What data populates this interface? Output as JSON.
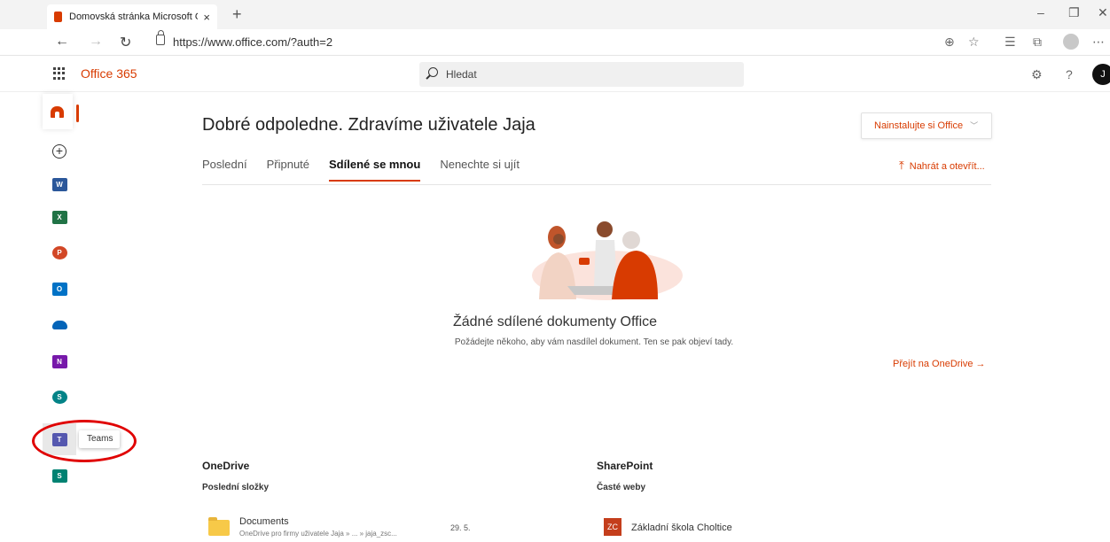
{
  "browser": {
    "tab_title": "Domovská stránka Microsoft Offi",
    "tab_close": "×",
    "new_tab": "+",
    "url": "https://www.office.com/?auth=2",
    "window_controls": [
      "–",
      "❐",
      "✕"
    ]
  },
  "header": {
    "brand": "Office 365",
    "search_placeholder": "Hledat",
    "user_initial": "J",
    "icons": [
      "gear-icon",
      "help-icon"
    ]
  },
  "rail": {
    "apps": [
      "home",
      "create",
      "word",
      "excel",
      "powerpoint",
      "outlook",
      "onedrive",
      "onenote",
      "sharepoint",
      "teams",
      "sway"
    ],
    "tooltip": "Teams"
  },
  "main": {
    "greeting": "Dobré odpoledne. Zdravíme uživatele Jaja",
    "install_button": "Nainstalujte si Office",
    "tabs": [
      "Poslední",
      "Připnuté",
      "Sdílené se mnou",
      "Nenechte si ujít"
    ],
    "active_tab": "Sdílené se mnou",
    "upload_link": "Nahrát a otevřít...",
    "empty_title": "Žádné sdílené dokumenty Office",
    "empty_subtitle": "Požádejte někoho, aby vám nasdílel dokument. Ten se pak objeví tady.",
    "onedrive_link": "Přejít na OneDrive →"
  },
  "onedrive": {
    "title": "OneDrive",
    "subtitle": "Poslední složky",
    "items": [
      {
        "name": "Documents",
        "path": "OneDrive pro firmy uživatele Jaja » ... » jaja_zsc...",
        "date": "29. 5."
      }
    ]
  },
  "sharepoint": {
    "title": "SharePoint",
    "subtitle": "Časté weby",
    "items": [
      {
        "initials": "ZC",
        "name": "Základní škola Choltice"
      }
    ]
  },
  "colors": {
    "accent": "#d83b01",
    "annotation": "#e00000"
  }
}
